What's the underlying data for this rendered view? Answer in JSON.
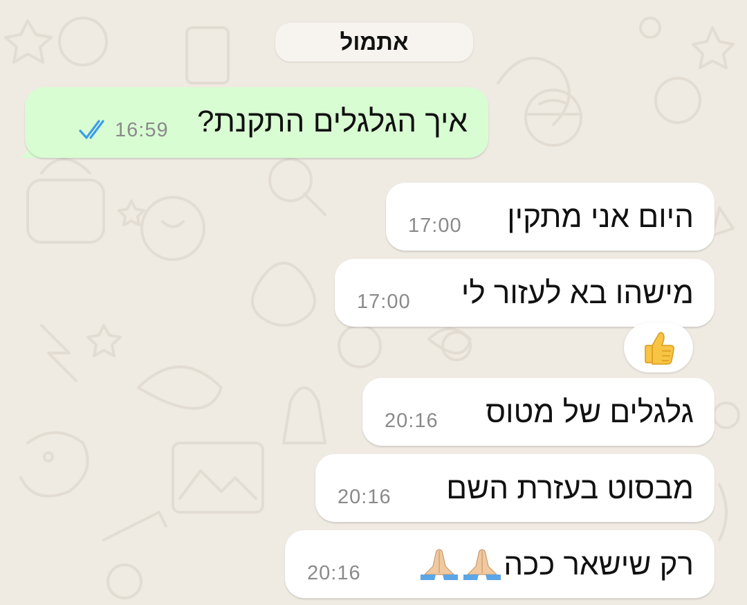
{
  "date_chip": "אתמול",
  "messages": [
    {
      "text": "איך הגלגלים התקנת?",
      "time": "16:59",
      "direction": "outgoing",
      "status": "read"
    },
    {
      "text": "היום אני מתקין",
      "time": "17:00",
      "direction": "incoming"
    },
    {
      "text": "מישהו בא לעזור לי",
      "time": "17:00",
      "direction": "incoming",
      "reaction": "thumbs-up"
    },
    {
      "text": "גלגלים של מטוס",
      "time": "20:16",
      "direction": "incoming"
    },
    {
      "text": "מבסוט בעזרת השם",
      "time": "20:16",
      "direction": "incoming"
    },
    {
      "text": "רק שישאר ככה",
      "time": "20:16",
      "direction": "incoming",
      "trailing_icons": [
        "praying-hands-icon",
        "praying-hands-icon"
      ]
    }
  ],
  "colors": {
    "background": "#efeae2",
    "outgoing_bubble": "#d9fdd3",
    "incoming_bubble": "#ffffff",
    "read_ticks": "#3b9de8",
    "time_text": "#8a8a8a"
  }
}
